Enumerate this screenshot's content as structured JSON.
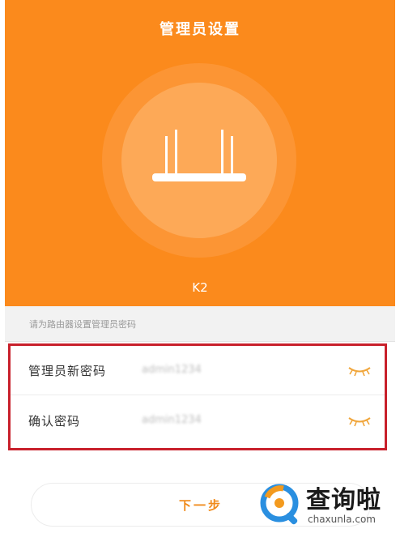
{
  "header": {
    "title": "管理员设置"
  },
  "device": {
    "model": "K2"
  },
  "hint": "请为路由器设置管理员密码",
  "form": {
    "rows": [
      {
        "label": "管理员新密码",
        "value": "admin1234"
      },
      {
        "label": "确认密码",
        "value": "admin1234"
      }
    ]
  },
  "next_button": {
    "label": "下一步"
  },
  "watermark": {
    "name": "查询啦",
    "domain": "chaxunla.com"
  },
  "colors": {
    "brand": "#fb8a1c",
    "highlight_border": "#c8202b",
    "accent_text": "#f08a1a"
  },
  "icons": {
    "router": "router-icon",
    "eye_closed": "eye-closed-icon",
    "search": "search-icon"
  }
}
